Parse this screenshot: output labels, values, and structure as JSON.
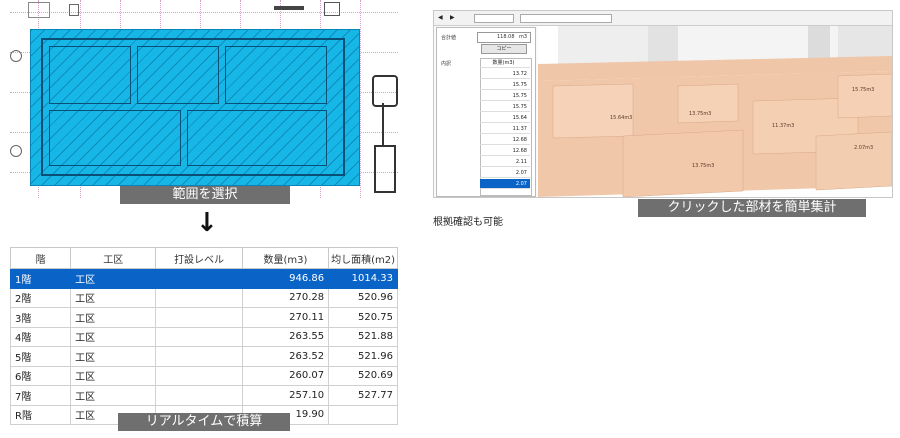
{
  "captions": {
    "select_range": "範囲を選択",
    "realtime": "リアルタイムで積算",
    "click_sum": "クリックした部材を簡単集計",
    "basis_check": "根拠確認も可能"
  },
  "arrow": "↓",
  "table": {
    "headers": [
      "階",
      "工区",
      "打設レベル",
      "数量(m3)",
      "均し面積(m2)"
    ],
    "rows": [
      {
        "floor": "1階",
        "zone": "工区",
        "level": "",
        "qty": "946.86",
        "area": "1014.33",
        "selected": true
      },
      {
        "floor": "2階",
        "zone": "工区",
        "level": "",
        "qty": "270.28",
        "area": "520.96"
      },
      {
        "floor": "3階",
        "zone": "工区",
        "level": "",
        "qty": "270.11",
        "area": "520.75"
      },
      {
        "floor": "4階",
        "zone": "工区",
        "level": "",
        "qty": "263.55",
        "area": "521.88"
      },
      {
        "floor": "5階",
        "zone": "工区",
        "level": "",
        "qty": "263.52",
        "area": "521.96"
      },
      {
        "floor": "6階",
        "zone": "工区",
        "level": "",
        "qty": "260.07",
        "area": "520.69"
      },
      {
        "floor": "7階",
        "zone": "工区",
        "level": "",
        "qty": "257.10",
        "area": "527.77"
      },
      {
        "floor": "R階",
        "zone": "工区",
        "level": "",
        "qty": "19.90",
        "area": ""
      }
    ]
  },
  "panel": {
    "total_label": "合計値",
    "total_value": "118.08",
    "total_unit": "m3",
    "copy_button": "コピー",
    "detail_label": "内訳",
    "column_header": "数量(m3)",
    "values": [
      "13.72",
      "15.75",
      "15.75",
      "15.75",
      "15.64",
      "11.37",
      "12.68",
      "12.68",
      "2.11",
      "2.07",
      "2.07"
    ]
  },
  "volume_tags": [
    "15.64m3",
    "13.75m3",
    "11.37m3",
    "2.07m3",
    "13.75m3",
    "15.75m3"
  ],
  "colors": {
    "selection": "#16b7e6",
    "row_selected": "#0a64c8",
    "caption_bg": "#6f6f6f",
    "concrete": "#f0c7a8"
  }
}
